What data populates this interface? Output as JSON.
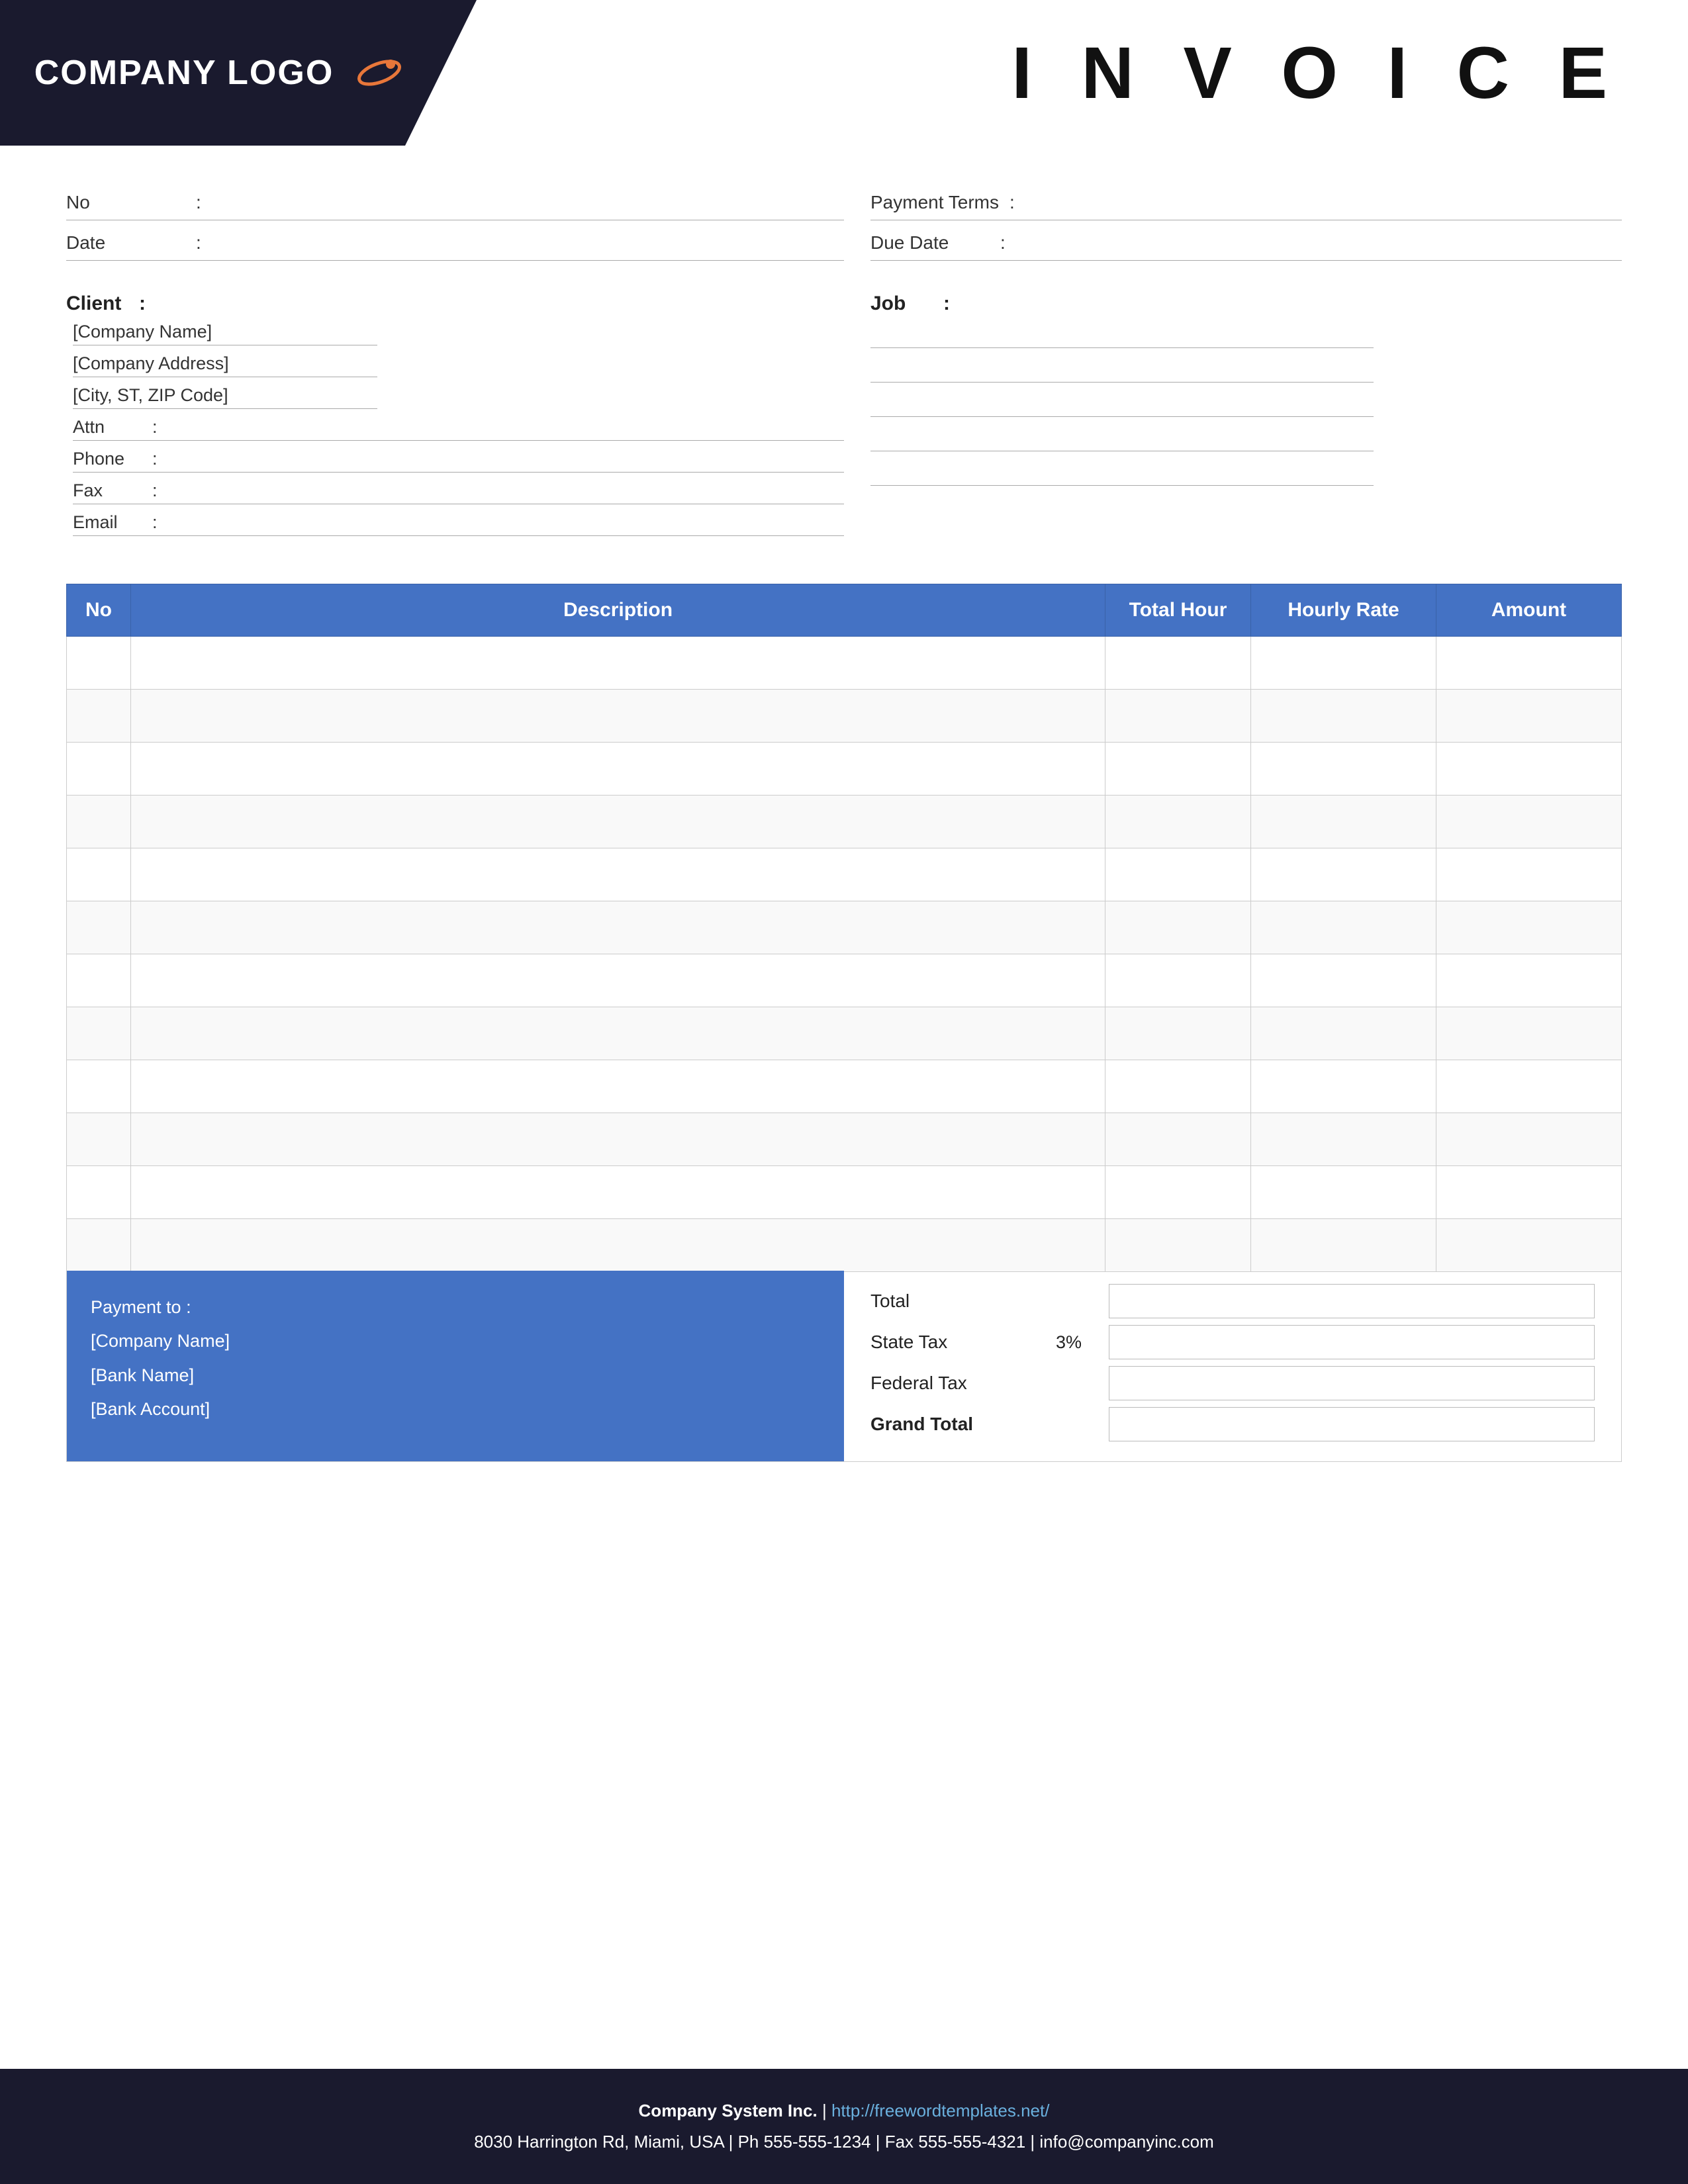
{
  "header": {
    "logo_text": "COMPANY LOGO",
    "invoice_title": "I N V O I C E"
  },
  "meta": {
    "no_label": "No",
    "no_colon": ":",
    "no_value": "",
    "date_label": "Date",
    "date_colon": ":",
    "date_value": "",
    "payment_terms_label": "Payment  Terms",
    "payment_terms_colon": ":",
    "payment_terms_value": "",
    "due_date_label": "Due Date",
    "due_date_colon": ":",
    "due_date_value": ""
  },
  "client": {
    "label": "Client",
    "colon": ":",
    "company_name": "[Company Name]",
    "company_address": "[Company Address]",
    "city_zip": "[City, ST, ZIP Code]",
    "attn_label": "Attn",
    "attn_colon": ":",
    "attn_value": "",
    "phone_label": "Phone",
    "phone_colon": ":",
    "phone_value": "",
    "fax_label": "Fax",
    "fax_colon": ":",
    "fax_value": "",
    "email_label": "Email",
    "email_colon": ":",
    "email_value": ""
  },
  "job": {
    "label": "Job",
    "colon": ":"
  },
  "table": {
    "col_no": "No",
    "col_description": "Description",
    "col_total_hour": "Total Hour",
    "col_hourly_rate": "Hourly Rate",
    "col_amount": "Amount",
    "rows": [
      {
        "no": "",
        "description": "",
        "total_hour": "",
        "hourly_rate": "",
        "amount": ""
      },
      {
        "no": "",
        "description": "",
        "total_hour": "",
        "hourly_rate": "",
        "amount": ""
      },
      {
        "no": "",
        "description": "",
        "total_hour": "",
        "hourly_rate": "",
        "amount": ""
      },
      {
        "no": "",
        "description": "",
        "total_hour": "",
        "hourly_rate": "",
        "amount": ""
      },
      {
        "no": "",
        "description": "",
        "total_hour": "",
        "hourly_rate": "",
        "amount": ""
      },
      {
        "no": "",
        "description": "",
        "total_hour": "",
        "hourly_rate": "",
        "amount": ""
      },
      {
        "no": "",
        "description": "",
        "total_hour": "",
        "hourly_rate": "",
        "amount": ""
      },
      {
        "no": "",
        "description": "",
        "total_hour": "",
        "hourly_rate": "",
        "amount": ""
      },
      {
        "no": "",
        "description": "",
        "total_hour": "",
        "hourly_rate": "",
        "amount": ""
      },
      {
        "no": "",
        "description": "",
        "total_hour": "",
        "hourly_rate": "",
        "amount": ""
      },
      {
        "no": "",
        "description": "",
        "total_hour": "",
        "hourly_rate": "",
        "amount": ""
      },
      {
        "no": "",
        "description": "",
        "total_hour": "",
        "hourly_rate": "",
        "amount": ""
      }
    ]
  },
  "payment": {
    "label": "Payment to :",
    "company_name": "[Company Name]",
    "bank_name": "[Bank Name]",
    "bank_account": "[Bank Account]"
  },
  "summary": {
    "total_label": "Total",
    "state_tax_label": "State Tax",
    "state_tax_pct": "3%",
    "federal_tax_label": "Federal Tax",
    "grand_total_label": "Grand Total",
    "total_value": "",
    "state_tax_value": "",
    "federal_tax_value": "",
    "grand_total_value": ""
  },
  "footer": {
    "company": "Company System Inc.",
    "separator": " | ",
    "website": "http://freewordtemplates.net/",
    "address": "8030 Harrington Rd, Miami, USA | Ph 555-555-1234 | Fax 555-555-4321 | info@companyinc.com"
  }
}
